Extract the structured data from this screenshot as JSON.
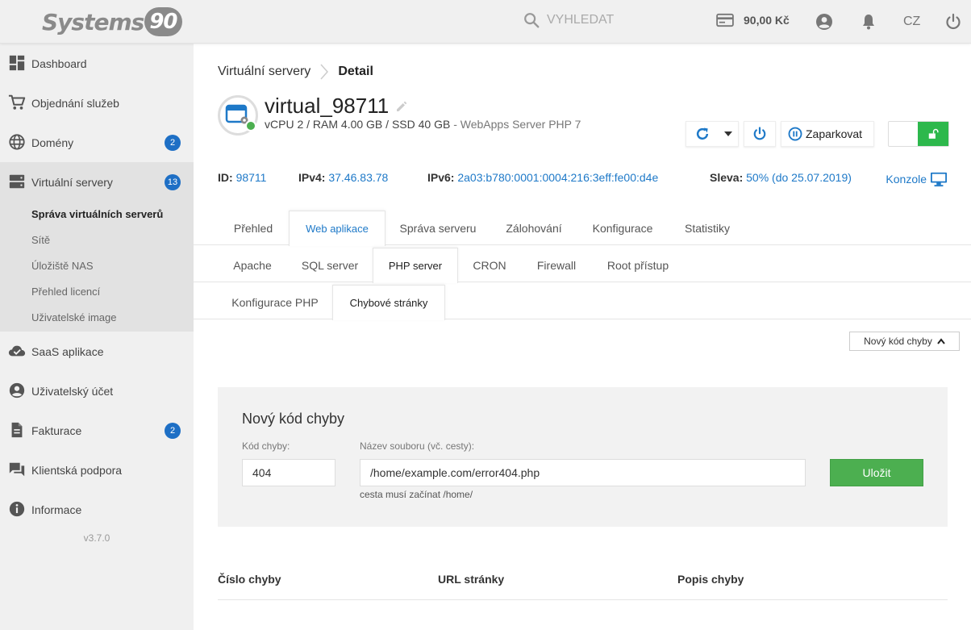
{
  "header": {
    "logo_text": "Systems",
    "logo_badge": "90",
    "search_placeholder": "VYHLEDAT",
    "credit": "90,00 Kč",
    "language": "CZ"
  },
  "sidebar": {
    "items": [
      {
        "label": "Dashboard",
        "icon": "dashboard-icon"
      },
      {
        "label": "Objednání služeb",
        "icon": "cart-icon"
      },
      {
        "label": "Domény",
        "icon": "globe-icon",
        "badge": "2"
      },
      {
        "label": "Virtuální servery",
        "icon": "server-icon",
        "badge": "13"
      },
      {
        "label": "SaaS aplikace",
        "icon": "cloud-check-icon"
      },
      {
        "label": "Uživatelský účet",
        "icon": "account-icon"
      },
      {
        "label": "Fakturace",
        "icon": "document-icon",
        "badge": "2"
      },
      {
        "label": "Klientská podpora",
        "icon": "chat-icon"
      },
      {
        "label": "Informace",
        "icon": "info-icon"
      }
    ],
    "submenu": [
      "Správa virtuálních serverů",
      "Sítě",
      "Úložiště NAS",
      "Přehled licencí",
      "Uživatelské image"
    ],
    "version": "v3.7.0"
  },
  "breadcrumb": {
    "parent": "Virtuální servery",
    "current": "Detail"
  },
  "server": {
    "name": "virtual_98711",
    "spec": "vCPU 2 / RAM 4.00 GB / SSD 40 GB",
    "spec_suffix": "- WebApps Server PHP 7",
    "park_label": "Zaparkovat",
    "status_color": "#4caf50"
  },
  "info": {
    "id_label": "ID:",
    "id_value": "98711",
    "ipv4_label": "IPv4:",
    "ipv4_value": "37.46.83.78",
    "ipv6_label": "IPv6:",
    "ipv6_value": "2a03:b780:0001:0004:216:3eff:fe00:d4e",
    "discount_label": "Sleva:",
    "discount_value": "50% (do 25.07.2019)",
    "console_label": "Konzole"
  },
  "tabs": {
    "level1": [
      "Přehled",
      "Web aplikace",
      "Správa serveru",
      "Zálohování",
      "Konfigurace",
      "Statistiky"
    ],
    "level2": [
      "Apache",
      "SQL server",
      "PHP server",
      "CRON",
      "Firewall",
      "Root přístup"
    ],
    "level3": [
      "Konfigurace PHP",
      "Chybové stránky"
    ]
  },
  "form": {
    "toggle_button": "Nový kód chyby",
    "title": "Nový kód chyby",
    "code_label": "Kód chyby:",
    "code_value": "404",
    "file_label": "Název souboru (vč. cesty):",
    "file_value": "/home/example.com/error404.php",
    "hint": "cesta musí začínat /home/",
    "save_label": "Uložit"
  },
  "table": {
    "headers": [
      "Číslo chyby",
      "URL stránky",
      "Popis chyby"
    ]
  },
  "colors": {
    "accent": "#1e79c8",
    "badge": "#1e6fc5",
    "success": "#4caf50"
  }
}
